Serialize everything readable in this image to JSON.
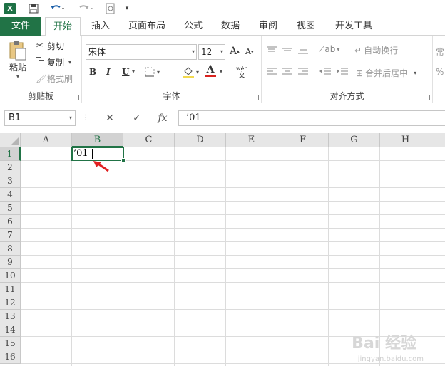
{
  "app": {
    "logo_text": "X",
    "accent": "#217346"
  },
  "quick_access": {
    "save_icon": "save-icon",
    "undo_icon": "undo-icon",
    "redo_icon": "redo-icon",
    "preview_icon": "print-preview-icon"
  },
  "tabs": [
    {
      "label": "文件"
    },
    {
      "label": "开始"
    },
    {
      "label": "插入"
    },
    {
      "label": "页面布局"
    },
    {
      "label": "公式"
    },
    {
      "label": "数据"
    },
    {
      "label": "审阅"
    },
    {
      "label": "视图"
    },
    {
      "label": "开发工具"
    }
  ],
  "ribbon": {
    "clipboard": {
      "paste": "粘贴",
      "cut": "剪切",
      "copy": "复制",
      "format_painter": "格式刷",
      "label": "剪贴板"
    },
    "font": {
      "font_name": "宋体",
      "font_size": "12",
      "grow": "A",
      "shrink": "A",
      "bold": "B",
      "italic": "I",
      "underline": "U",
      "font_color": "A",
      "phonetic": "wén",
      "label": "字体"
    },
    "alignment": {
      "wrap_text": "自动换行",
      "merge_center": "合并后居中",
      "label": "对齐方式"
    },
    "number": {
      "format_prefix": "常"
    }
  },
  "formula_bar": {
    "name_box": "B1",
    "cancel": "✕",
    "enter": "✓",
    "fx": "fx",
    "content": "’01"
  },
  "grid": {
    "columns": [
      "A",
      "B",
      "C",
      "D",
      "E",
      "F",
      "G",
      "H"
    ],
    "rows": [
      "1",
      "2",
      "3",
      "4",
      "5",
      "6",
      "7",
      "8",
      "9",
      "10",
      "11",
      "12",
      "13",
      "14",
      "15",
      "16"
    ],
    "active_cell": "B1",
    "cell_value": "’01"
  },
  "watermark": {
    "text": "Bai 经验",
    "sub": "jingyan.baidu.com"
  },
  "colors": {
    "selection": "#217346",
    "arrow": "#e02020"
  }
}
